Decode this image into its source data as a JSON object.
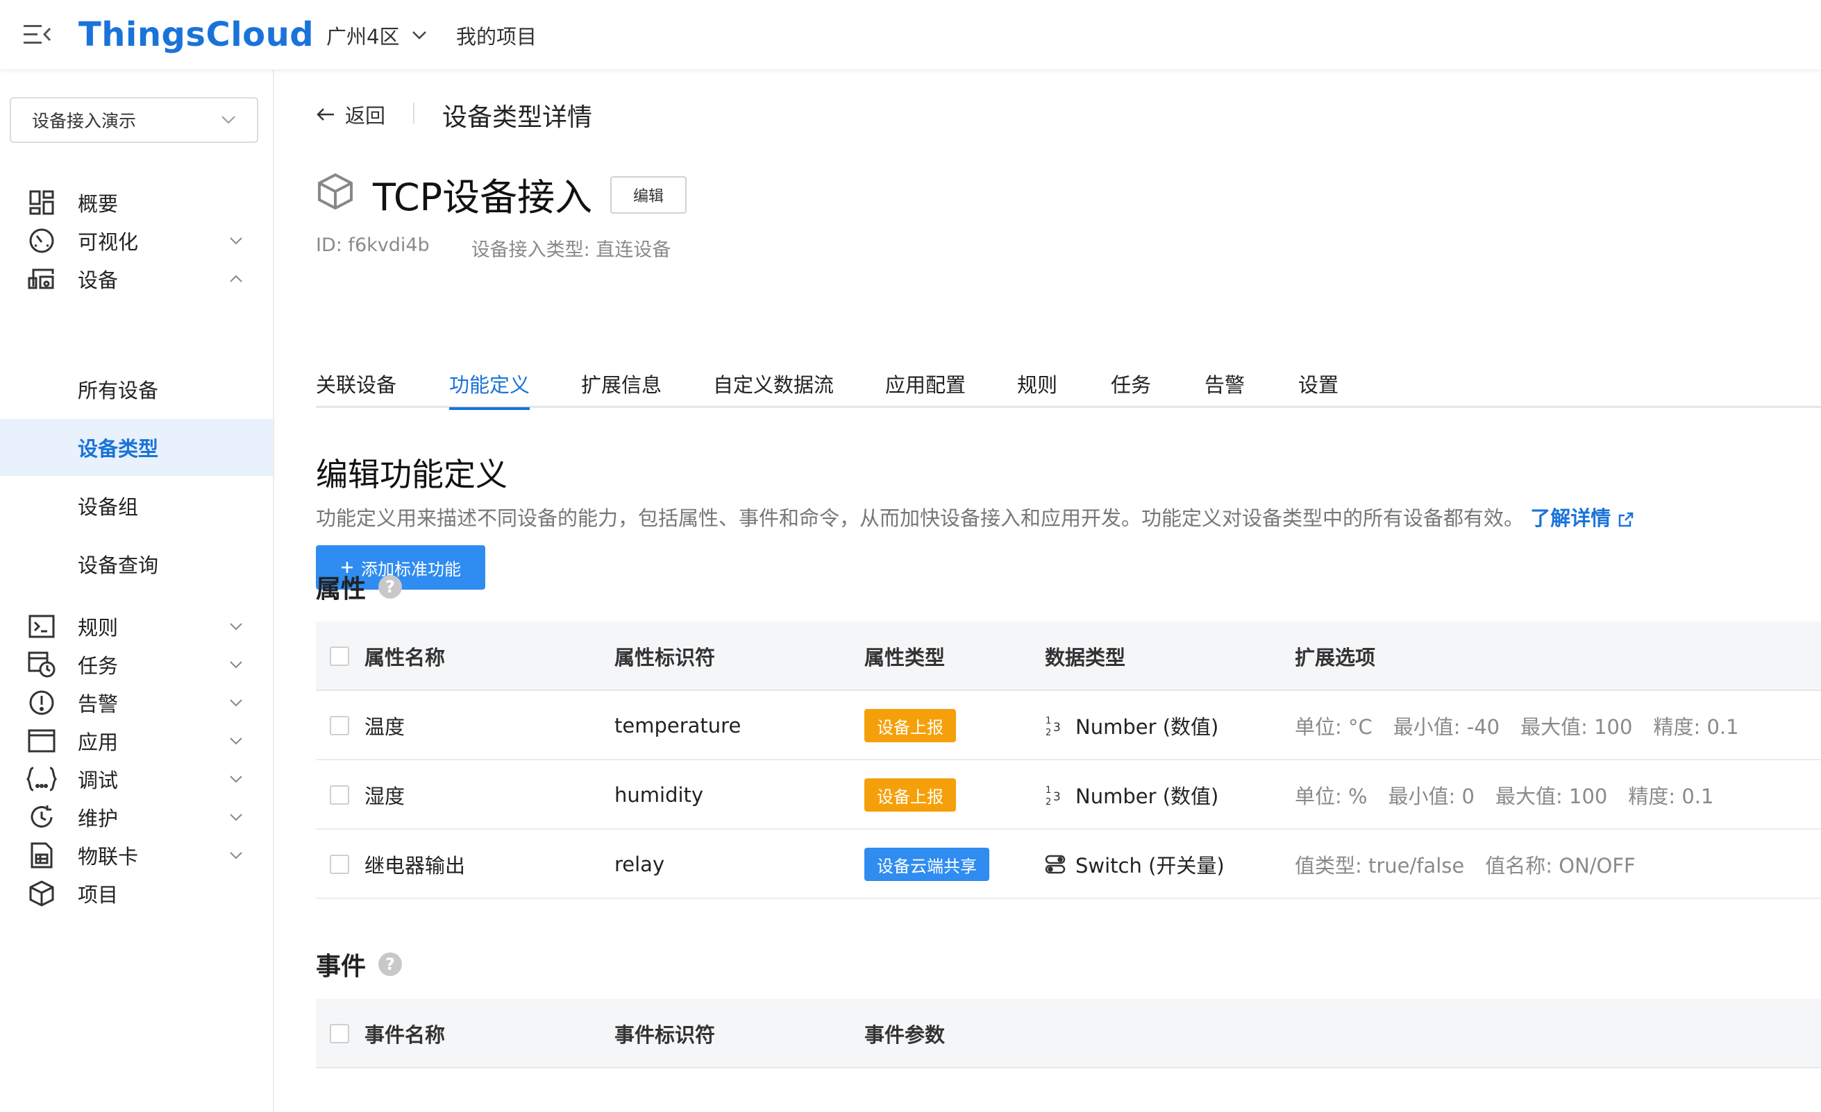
{
  "header": {
    "logo": "ThingsCloud",
    "region": "广州4区",
    "project_link": "我的项目"
  },
  "sidebar": {
    "project_select": "设备接入演示",
    "items": [
      {
        "label": "概要",
        "icon": "dashboard-icon"
      },
      {
        "label": "可视化",
        "icon": "gauge-icon"
      },
      {
        "label": "设备",
        "icon": "device-icon"
      },
      {
        "label": "规则",
        "icon": "terminal-icon"
      },
      {
        "label": "任务",
        "icon": "task-icon"
      },
      {
        "label": "告警",
        "icon": "alert-icon"
      },
      {
        "label": "应用",
        "icon": "window-icon"
      },
      {
        "label": "调试",
        "icon": "braces-icon"
      },
      {
        "label": "维护",
        "icon": "maintenance-icon"
      },
      {
        "label": "物联卡",
        "icon": "sim-card-icon"
      },
      {
        "label": "项目",
        "icon": "cube-icon"
      }
    ],
    "device_sub": [
      "所有设备",
      "设备类型",
      "设备组",
      "设备查询"
    ]
  },
  "breadcrumb": {
    "back": "返回",
    "title": "设备类型详情"
  },
  "device_type": {
    "name": "TCP设备接入",
    "edit": "编辑",
    "id": "ID: f6kvdi4b",
    "access_type": "设备接入类型: 直连设备"
  },
  "tabs": [
    "关联设备",
    "功能定义",
    "扩展信息",
    "自定义数据流",
    "应用配置",
    "规则",
    "任务",
    "告警",
    "设置"
  ],
  "active_tab": "功能定义",
  "section": {
    "title": "编辑功能定义",
    "description": "功能定义用来描述不同设备的能力，包括属性、事件和命令，从而加快设备接入和应用开发。功能定义对设备类型中的所有设备都有效。",
    "learn_more": "了解详情",
    "add_button": "添加标准功能"
  },
  "properties": {
    "title": "属性",
    "headers": [
      "属性名称",
      "属性标识符",
      "属性类型",
      "数据类型",
      "扩展选项"
    ],
    "rows": [
      {
        "name": "温度",
        "identifier": "temperature",
        "type": "设备上报",
        "type_color": "#f5a00a",
        "data_type": "Number (数值)",
        "ext": [
          "单位: °C",
          "最小值: -40",
          "最大值: 100",
          "精度: 0.1"
        ]
      },
      {
        "name": "湿度",
        "identifier": "humidity",
        "type": "设备上报",
        "type_color": "#f5a00a",
        "data_type": "Number (数值)",
        "ext": [
          "单位: %",
          "最小值: 0",
          "最大值: 100",
          "精度: 0.1"
        ]
      },
      {
        "name": "继电器输出",
        "identifier": "relay",
        "type": "设备云端共享",
        "type_color": "#2f8cf0",
        "data_type": "Switch (开关量)",
        "ext": [
          "值类型: true/false",
          "值名称: ON/OFF"
        ]
      }
    ]
  },
  "events": {
    "title": "事件",
    "headers": [
      "事件名称",
      "事件标识符",
      "事件参数"
    ]
  },
  "colors": {
    "accent": "#1a73d9",
    "button": "#2f8cf0",
    "orange_badge": "#f5a00a"
  }
}
